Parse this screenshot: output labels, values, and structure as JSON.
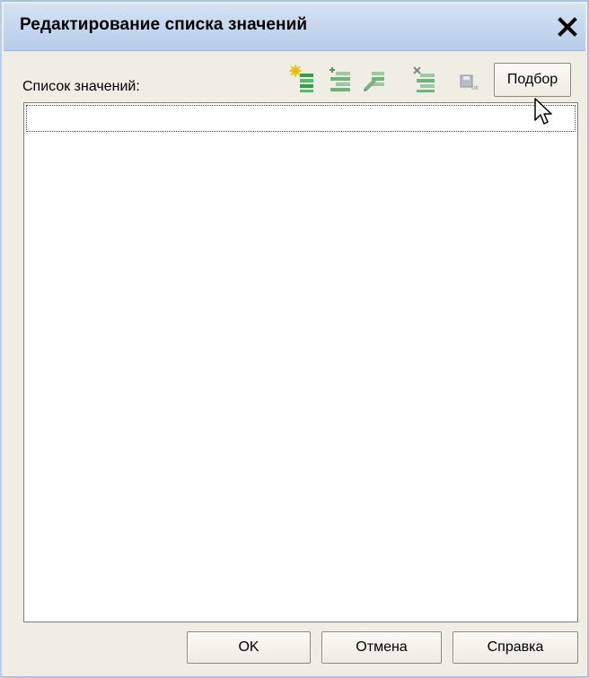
{
  "window": {
    "title": "Редактирование списка значений"
  },
  "list": {
    "label": "Список значений:",
    "rows": [
      ""
    ]
  },
  "toolbar": {
    "icons": [
      {
        "name": "add-item-icon"
      },
      {
        "name": "add-child-item-icon"
      },
      {
        "name": "edit-item-icon"
      },
      {
        "name": "delete-item-icon"
      },
      {
        "name": "save-ok-icon"
      }
    ],
    "podbor_label": "Подбор"
  },
  "buttons": {
    "ok": "OK",
    "cancel": "Отмена",
    "help": "Справка"
  },
  "colors": {
    "titlebar": "#c3d6ee",
    "window_bg": "#f0eee4",
    "icon_green": "#3c9a4a",
    "icon_yellow": "#f2d23a"
  }
}
